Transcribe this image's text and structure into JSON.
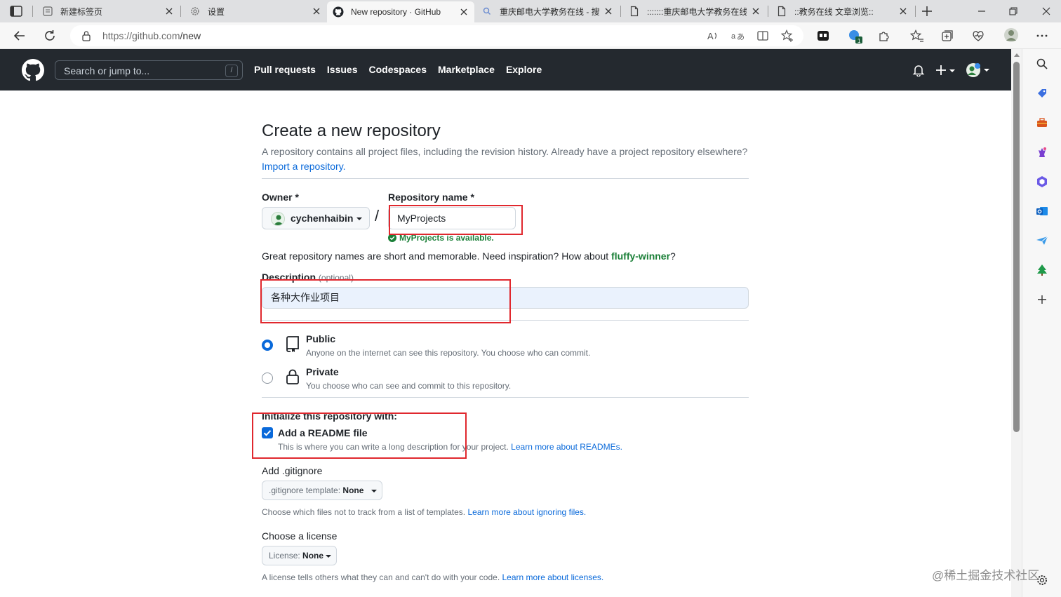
{
  "browser": {
    "tabs": [
      {
        "title": "新建标签页",
        "icon": "new-tab-icon",
        "active": false
      },
      {
        "title": "设置",
        "icon": "gear-icon",
        "active": false
      },
      {
        "title": "New repository · GitHub",
        "icon": "github-icon",
        "active": true
      },
      {
        "title": "重庆邮电大学教务在线 - 搜索",
        "icon": "search-icon",
        "active": false
      },
      {
        "title": ":::::::重庆邮电大学教务在线",
        "icon": "page-icon",
        "active": false
      },
      {
        "title": "::教务在线 文章浏览::",
        "icon": "page-icon",
        "active": false
      }
    ],
    "url_host": "https://github.com",
    "url_path": "/new"
  },
  "github": {
    "search_placeholder": "Search or jump to...",
    "search_shortcut": "/",
    "nav": [
      "Pull requests",
      "Issues",
      "Codespaces",
      "Marketplace",
      "Explore"
    ]
  },
  "form": {
    "title": "Create a new repository",
    "subtitle": "A repository contains all project files, including the revision history. Already have a project repository elsewhere?",
    "import_link": "Import a repository.",
    "owner_label": "Owner *",
    "owner_value": "cychenhaibin",
    "separator": "/",
    "repo_label": "Repository name *",
    "repo_value": "MyProjects",
    "availability": "MyProjects is available.",
    "hint_prefix": "Great repository names are short and memorable. Need inspiration? How about ",
    "hint_suggestion": "fluffy-winner",
    "hint_suffix": "?",
    "description_label": "Description",
    "description_optional": "(optional)",
    "description_value": "各种大作业项目",
    "visibility": [
      {
        "title": "Public",
        "desc": "Anyone on the internet can see this repository. You choose who can commit.",
        "checked": true
      },
      {
        "title": "Private",
        "desc": "You choose who can see and commit to this repository.",
        "checked": false
      }
    ],
    "init_title": "Initialize this repository with:",
    "readme_label": "Add a README file",
    "readme_checked": true,
    "readme_desc": "This is where you can write a long description for your project.",
    "readme_link": "Learn more about READMEs.",
    "gitignore_label": "Add .gitignore",
    "gitignore_prefix": ".gitignore template:",
    "gitignore_value": "None",
    "gitignore_note": "Choose which files not to track from a list of templates.",
    "gitignore_link": "Learn more about ignoring files.",
    "license_label": "Choose a license",
    "license_prefix": "License:",
    "license_value": "None",
    "license_note": "A license tells others what they can and can't do with your code.",
    "license_link": "Learn more about licenses."
  },
  "watermark": "@稀土掘金技术社区",
  "colors": {
    "header_bg": "#24292f",
    "link": "#0969da",
    "success": "#1a7f37",
    "annotation_red": "#e0282e",
    "description_bg": "#eaf2fd"
  }
}
